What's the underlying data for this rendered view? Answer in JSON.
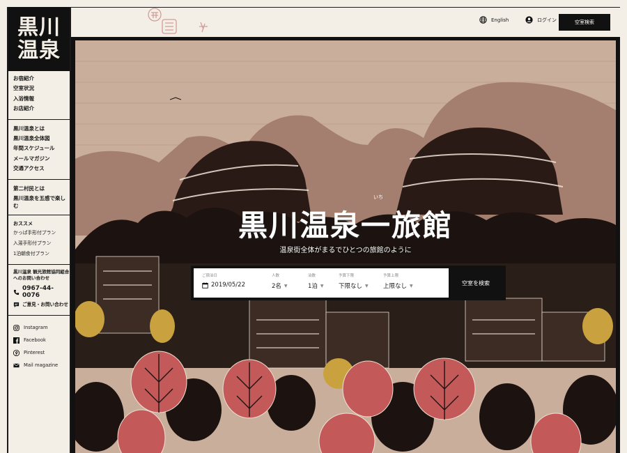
{
  "logo": {
    "line1": "黒川",
    "line2": "温泉"
  },
  "nav": {
    "group1": [
      "お宿紹介",
      "空室状況",
      "入浴情報",
      "お店紹介"
    ],
    "group2": [
      "黒川温泉とは",
      "黒川温泉全体図",
      "年間スケジュール",
      "メールマガジン",
      "交通アクセス"
    ],
    "group3": [
      "第二村民とは",
      "黒川温泉を五感で楽しむ"
    ],
    "recommend": {
      "heading": "おススメ",
      "items": [
        "かっぱ手形付プラン",
        "入湯手形付プラン",
        "1泊朝食付プラン"
      ]
    }
  },
  "association": {
    "name": "黒川温泉 観光旅館協同組合へのお問い合わせ",
    "phone": "0967-44-0076",
    "contact": "ご意見・お問い合わせ"
  },
  "social": [
    "Instagram",
    "Facebook",
    "Pinterest",
    "Mail magazine"
  ],
  "header": {
    "english": "English",
    "login": "ログイン",
    "vacancy": "空室検索"
  },
  "hero": {
    "title": "黒川温泉一旅館",
    "ruby": "いち",
    "subtitle": "温泉街全体がまるでひとつの旅館のように"
  },
  "search": {
    "checkin": {
      "label": "ご宿泊日",
      "value": "2019/05/22"
    },
    "guests": {
      "label": "人数",
      "value": "2名"
    },
    "nights": {
      "label": "泊数",
      "value": "1泊"
    },
    "price_min": {
      "label": "予算下限",
      "value": "下限なし"
    },
    "price_max": {
      "label": "予算上限",
      "value": "上限なし"
    },
    "button": "空室を検索"
  },
  "colors": {
    "dark": "#111111",
    "paper": "#f4efe6",
    "sky": "#c8ad9a",
    "leaf_red": "#c4595a",
    "leaf_gold": "#c9a23f"
  }
}
